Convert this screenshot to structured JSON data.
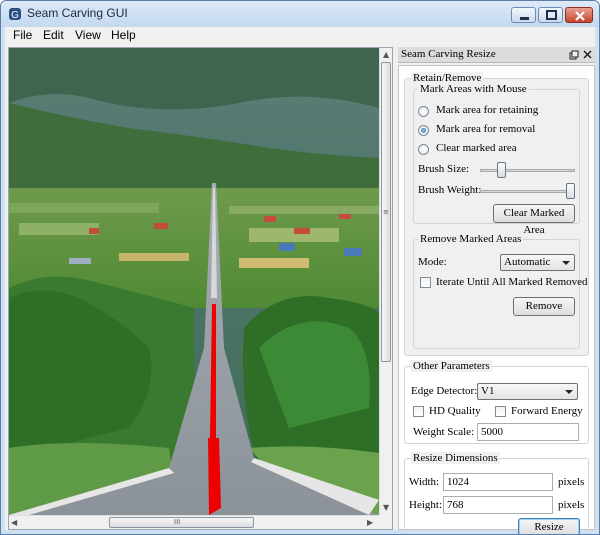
{
  "window": {
    "title": "Seam Carving GUI"
  },
  "menu": {
    "items": [
      "File",
      "Edit",
      "View",
      "Help"
    ]
  },
  "viewer": {
    "scrollbar_grip": "III"
  },
  "panel": {
    "title": "Seam Carving Resize",
    "retain_remove": {
      "legend": "Retain/Remove",
      "mark_legend": "Mark Areas with Mouse",
      "options": [
        "Mark area for retaining",
        "Mark area for removal",
        "Clear marked area"
      ],
      "selected_option": "Mark area for removal",
      "brush_size_label": "Brush Size:",
      "brush_size_fraction": 0.2,
      "brush_weight_label": "Brush Weight:",
      "brush_weight_fraction": 1.0,
      "clear_button": "Clear Marked Area"
    },
    "remove_marked": {
      "legend": "Remove Marked Areas",
      "mode_label": "Mode:",
      "mode_value": "Automatic",
      "iterate_label": "Iterate Until All Marked Removed",
      "iterate_checked": false,
      "remove_button": "Remove"
    },
    "other_params": {
      "legend": "Other Parameters",
      "edge_label": "Edge Detector:",
      "edge_value": "V1",
      "hd_label": "HD Quality",
      "hd_checked": false,
      "forward_label": "Forward Energy",
      "forward_checked": false,
      "weight_label": "Weight Scale:",
      "weight_value": "5000"
    },
    "resize": {
      "legend": "Resize Dimensions",
      "width_label": "Width:",
      "width_value": "1024",
      "width_unit": "pixels",
      "height_label": "Height:",
      "height_value": "768",
      "height_unit": "pixels",
      "resize_button": "Resize"
    }
  },
  "colors": {
    "mark_removal": "#ee0000",
    "window_frame": "#cfe0f2",
    "default_button_border": "#3c7fb1"
  }
}
